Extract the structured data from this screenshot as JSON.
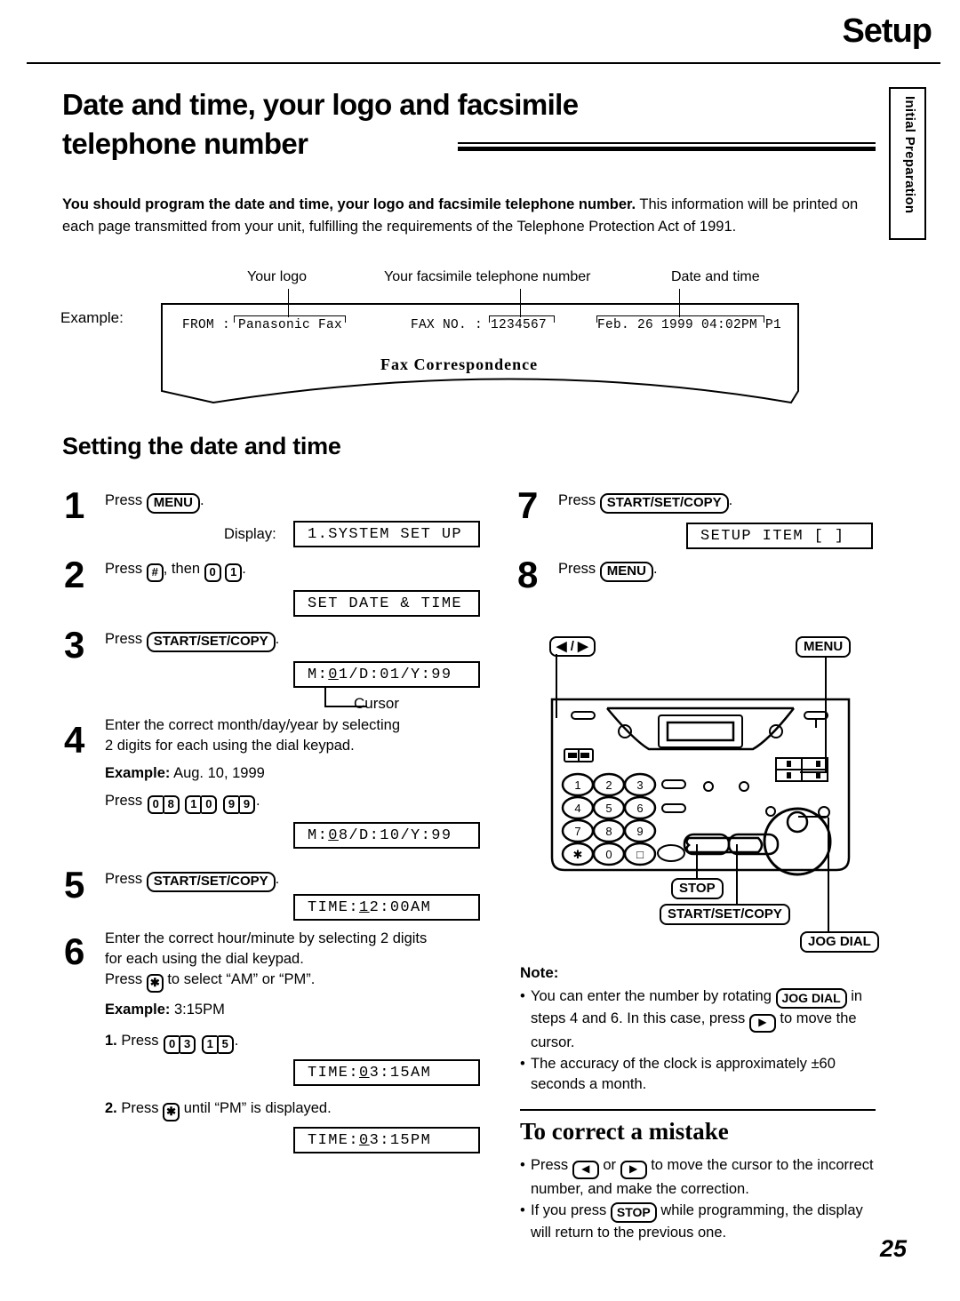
{
  "header": {
    "section_title": "Setup",
    "side_tab": "Initial Preparation"
  },
  "heading": {
    "line1": "Date and time, your logo and facsimile",
    "line2": "telephone number"
  },
  "intro": {
    "bold_part": "You should program the date and time, your logo and facsimile telephone number.",
    "rest": " This information will be printed on each page transmitted from your unit, fulfilling the requirements of the Telephone Protection Act of 1991."
  },
  "example": {
    "label": "Example:",
    "callout_logo": "Your logo",
    "callout_fax": "Your facsimile telephone number",
    "callout_date": "Date and time",
    "fax_from": "FROM : Panasonic Fax",
    "fax_no": "FAX NO. : 1234567",
    "fax_datetime": "Feb. 26 1999 04:02PM  P1",
    "fax_title": "Fax Correspondence"
  },
  "section": {
    "title": "Setting the date and time"
  },
  "steps": [
    {
      "num": "1",
      "text_pre": "Press ",
      "key": "MENU",
      "text_post": ".",
      "display_label": "Display:",
      "lcd": "1.SYSTEM SET UP"
    },
    {
      "num": "2",
      "text_pre": "Press ",
      "key_hash": "#",
      "text_mid": ", then ",
      "key_0": "0",
      "key_1": "1",
      "text_post": ".",
      "lcd": "SET DATE & TIME"
    },
    {
      "num": "3",
      "text_pre": "Press ",
      "key": "START/SET/COPY",
      "text_post": ".",
      "lcd_pre": "M:",
      "lcd_cursor": "0",
      "lcd_post": "1/D:01/Y:99",
      "cursor_label": "Cursor"
    },
    {
      "num": "4",
      "line1": "Enter the correct month/day/year by selecting",
      "line2": "2 digits for each using the dial keypad.",
      "example_label": "Example:",
      "example_value": "Aug. 10, 1999",
      "press_label": "Press",
      "keys": [
        "0",
        "8",
        "1",
        "0",
        "9",
        "9"
      ],
      "lcd_pre": "M:",
      "lcd_cursor": "0",
      "lcd_post": "8/D:10/Y:99"
    },
    {
      "num": "5",
      "text_pre": "Press ",
      "key": "START/SET/COPY",
      "text_post": ".",
      "lcd_pre": "TIME:   ",
      "lcd_cursor": "1",
      "lcd_post": "2:00AM"
    },
    {
      "num": "6",
      "line1": "Enter the correct hour/minute by selecting 2 digits",
      "line2": "for each using the dial keypad.",
      "line3_pre": "Press ",
      "line3_key": "✱",
      "line3_post": " to select “AM” or “PM”.",
      "example_label": "Example:",
      "example_value": "3:15PM",
      "sub1_num": "1.",
      "sub1_pre": "Press",
      "sub1_keys": [
        "0",
        "3",
        "1",
        "5"
      ],
      "sub1_post": ".",
      "sub1_lcd_pre": "TIME:   ",
      "sub1_lcd_cursor": "0",
      "sub1_lcd_post": "3:15AM",
      "sub2_num": "2.",
      "sub2_pre": "Press ",
      "sub2_key": "✱",
      "sub2_post": " until “PM” is displayed.",
      "sub2_lcd_pre": "TIME:   ",
      "sub2_lcd_cursor": "0",
      "sub2_lcd_post": "3:15PM"
    },
    {
      "num": "7",
      "text_pre": "Press ",
      "key": "START/SET/COPY",
      "text_post": ".",
      "lcd": "SETUP ITEM [  ]"
    },
    {
      "num": "8",
      "text_pre": "Press ",
      "key": "MENU",
      "text_post": "."
    }
  ],
  "machine": {
    "label_arrows": "◀ / ▶",
    "label_menu": "MENU",
    "label_stop": "STOP",
    "label_start": "START/SET/COPY",
    "label_jog": "JOG DIAL",
    "keypad": [
      "1",
      "2",
      "3",
      "4",
      "5",
      "6",
      "7",
      "8",
      "9",
      "✱",
      "0",
      "□"
    ]
  },
  "note": {
    "heading": "Note:",
    "item1_a": "You can enter the number by rotating ",
    "item1_key": "JOG DIAL",
    "item1_b": " in steps 4 and 6. In this case, press ",
    "item1_arrow": "▶",
    "item1_c": " to move the cursor.",
    "item2": "The accuracy of the clock is approximately ±60 seconds a month."
  },
  "correct": {
    "heading": "To correct a mistake",
    "item1_a": "Press ",
    "item1_left": "◀",
    "item1_b": " or ",
    "item1_right": "▶",
    "item1_c": " to move the cursor to the incorrect number, and make the correction.",
    "item2_a": "If you press ",
    "item2_key": "STOP",
    "item2_b": " while programming, the display will return to the previous one."
  },
  "page_number": "25"
}
